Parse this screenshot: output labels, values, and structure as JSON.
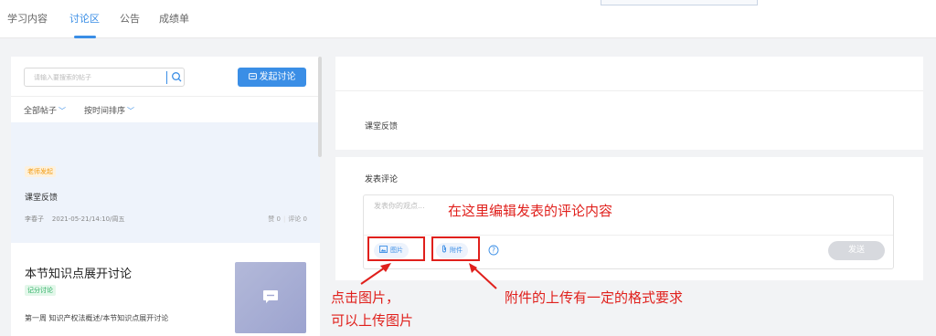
{
  "nav": {
    "tabs": [
      {
        "label": "学习内容"
      },
      {
        "label": "讨论区"
      },
      {
        "label": "公告"
      },
      {
        "label": "成绩单"
      }
    ],
    "active_tab": "讨论区"
  },
  "sidebar": {
    "search_placeholder": "请输入要搜索的帖子",
    "start_button": "发起讨论",
    "filters": [
      {
        "label": "全部帖子"
      },
      {
        "label": "按时间排序"
      }
    ],
    "posts": [
      {
        "badge": "老师发起",
        "title": "课堂反馈",
        "author": "李春子",
        "time": "2021-05-21/14:10/周五",
        "likes": "赞 0",
        "comments": "评论 0"
      },
      {
        "title": "本节知识点展开讨论",
        "badge": "记分讨论",
        "desc": "第一周 知识产权法概述/本节知识点展开讨论"
      }
    ]
  },
  "main": {
    "post_title": "课堂反馈",
    "comment_label": "发表评论",
    "comment_placeholder": "发表你的观点...",
    "image_button": "图片",
    "attach_button": "附件",
    "send_button": "发送"
  },
  "annotations": {
    "edit_hint": "在这里编辑发表的评论内容",
    "image_hint_1": "点击图片，",
    "image_hint_2": "可以上传图片",
    "attach_hint": "附件的上传有一定的格式要求"
  },
  "colors": {
    "accent": "#3a8ee6",
    "annotation": "#e0201c"
  }
}
